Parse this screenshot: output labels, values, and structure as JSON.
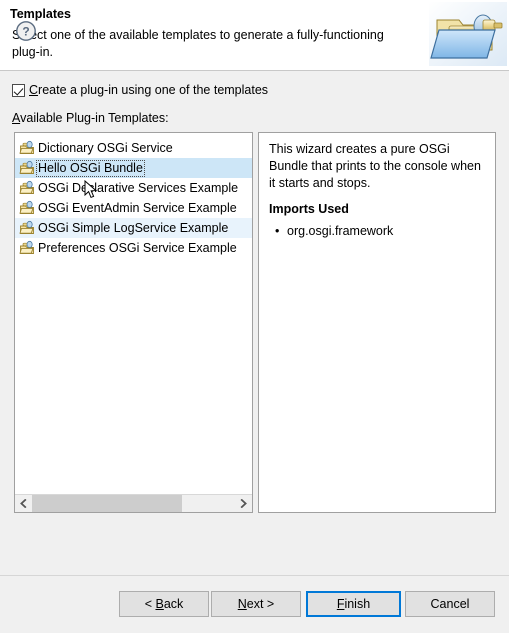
{
  "header": {
    "title": "Templates",
    "description": "Select one of the available templates to generate a fully-functioning plug-in.",
    "banner_icon": "plugin-folder-icon"
  },
  "checkbox": {
    "label_prefix": "",
    "mnemonic": "C",
    "label_rest": "reate a plug-in using one of the templates",
    "checked": true
  },
  "list_group": {
    "mnemonic": "A",
    "label_rest": "vailable Plug-in Templates:"
  },
  "templates": [
    {
      "name": "Dictionary OSGi Service",
      "icon": "plugin-icon",
      "selected": false,
      "alt": false
    },
    {
      "name": "Hello OSGi Bundle",
      "icon": "plugin-icon",
      "selected": true,
      "alt": false
    },
    {
      "name": "OSGi Declarative Services Example",
      "icon": "plugin-icon",
      "selected": false,
      "alt": false
    },
    {
      "name": "OSGi EventAdmin Service Example",
      "icon": "plugin-icon",
      "selected": false,
      "alt": false
    },
    {
      "name": "OSGi Simple LogService Example",
      "icon": "plugin-icon",
      "selected": false,
      "alt": true
    },
    {
      "name": "Preferences OSGi Service Example",
      "icon": "plugin-icon",
      "selected": false,
      "alt": false
    }
  ],
  "scrollbar": {
    "left_arrow_icon": "chevron-left-icon",
    "right_arrow_icon": "chevron-right-icon",
    "thumb_fraction": 0.74
  },
  "description": {
    "text": "This wizard creates a pure OSGi Bundle that prints to the console when it starts and stops.",
    "imports_heading": "Imports Used",
    "imports": [
      "org.osgi.framework"
    ]
  },
  "buttons": {
    "help_icon": "help-question-icon",
    "back": {
      "prefix": "< ",
      "mnemonic": "B",
      "rest": "ack"
    },
    "next": {
      "prefix": "",
      "mnemonic": "N",
      "rest": "ext >"
    },
    "finish": {
      "prefix": "",
      "mnemonic": "F",
      "rest": "inish"
    },
    "cancel": {
      "label": "Cancel"
    }
  },
  "colors": {
    "accent": "#0078D7",
    "selection": "#CDE6F7",
    "alt_row": "#E8F3FC",
    "dialog_bg": "#F0F0F0",
    "panel_bg": "#FFFFFF"
  }
}
